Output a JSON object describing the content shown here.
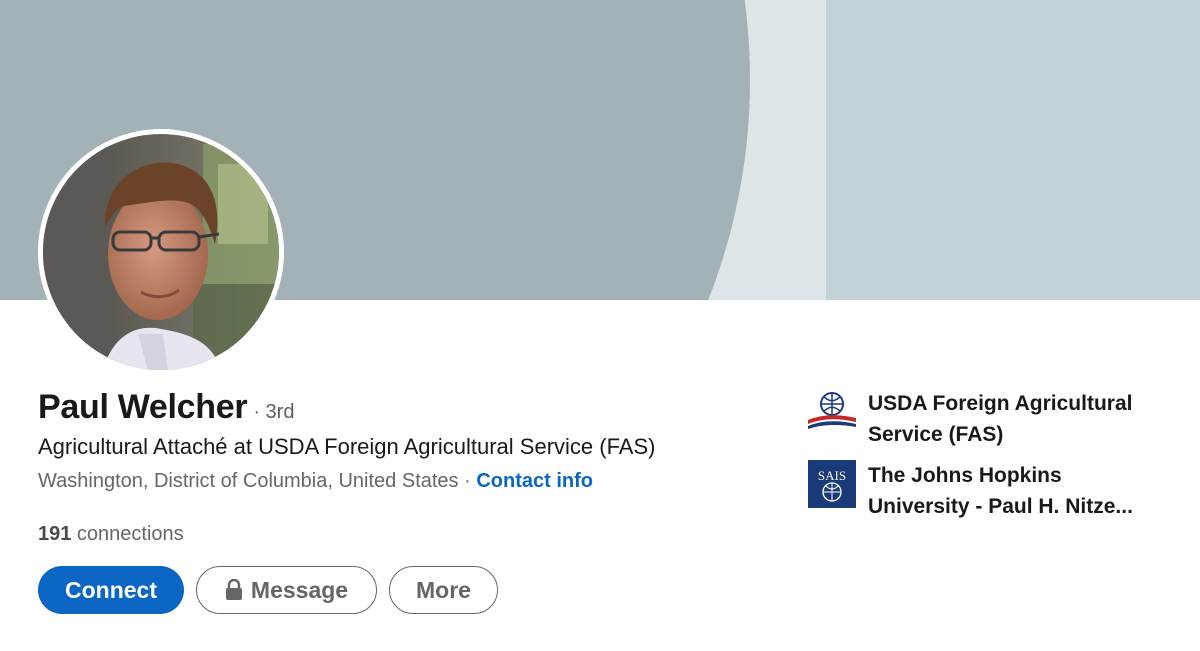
{
  "profile": {
    "name": "Paul Welcher",
    "degree": "· 3rd",
    "headline": "Agricultural Attaché at USDA Foreign Agricultural Service (FAS)",
    "location": "Washington, District of Columbia, United States",
    "separator": " · ",
    "contact_info": "Contact info",
    "connections_count": "191",
    "connections_label": " connections"
  },
  "actions": {
    "connect": "Connect",
    "message": "Message",
    "more": "More"
  },
  "icons": {
    "avatar": "profile-photo",
    "message": "lock-icon",
    "org_1_logo": "usda-fas-logo",
    "org_2_logo": "sais-logo"
  },
  "organizations": [
    {
      "name": "USDA Foreign Agricultural Service (FAS)"
    },
    {
      "name": "The Johns Hopkins University - Paul H. Nitze..."
    }
  ],
  "colors": {
    "accent": "#0a66c2",
    "banner_dark": "#a3b2b6",
    "banner_light": "#dde5e8",
    "banner_panel": "#c3d2d6",
    "sais_blue": "#1b3a7a"
  }
}
